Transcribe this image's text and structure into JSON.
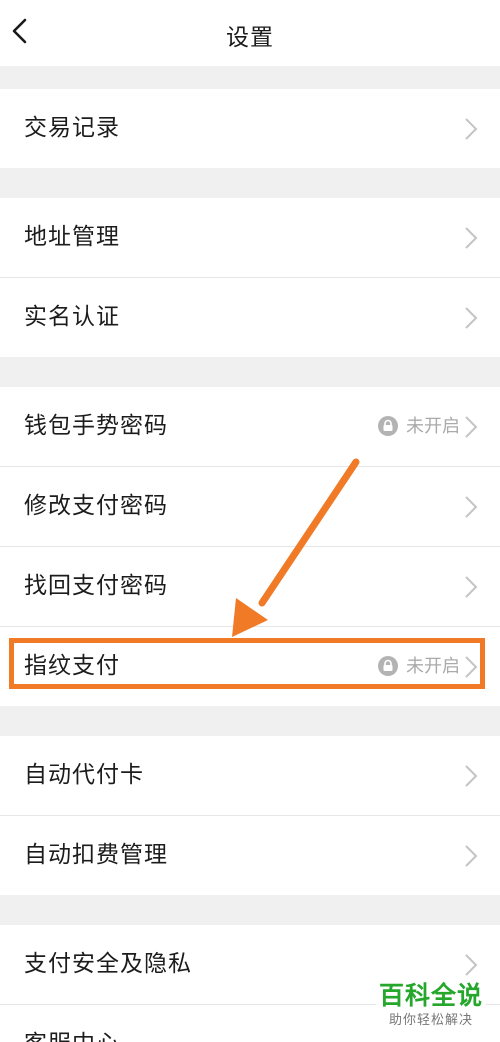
{
  "header": {
    "title": "设置",
    "back_icon": "chevron-left-icon"
  },
  "settings": {
    "transaction_records": "交易记录",
    "address_management": "地址管理",
    "real_name_auth": "实名认证",
    "wallet_gesture_password": "钱包手势密码",
    "wallet_gesture_status": "未开启",
    "change_pay_password": "修改支付密码",
    "retrieve_pay_password": "找回支付密码",
    "fingerprint_pay": "指纹支付",
    "fingerprint_pay_status": "未开启",
    "auto_pay_card": "自动代付卡",
    "auto_deduct_management": "自动扣费管理",
    "pay_security_privacy": "支付安全及隐私",
    "customer_service": "客服中心"
  },
  "annotation": {
    "arrow_color": "#f07a26",
    "highlight_color": "#f07a26"
  },
  "watermark": {
    "title": "百科全说",
    "subtitle": "助你轻松解决"
  }
}
